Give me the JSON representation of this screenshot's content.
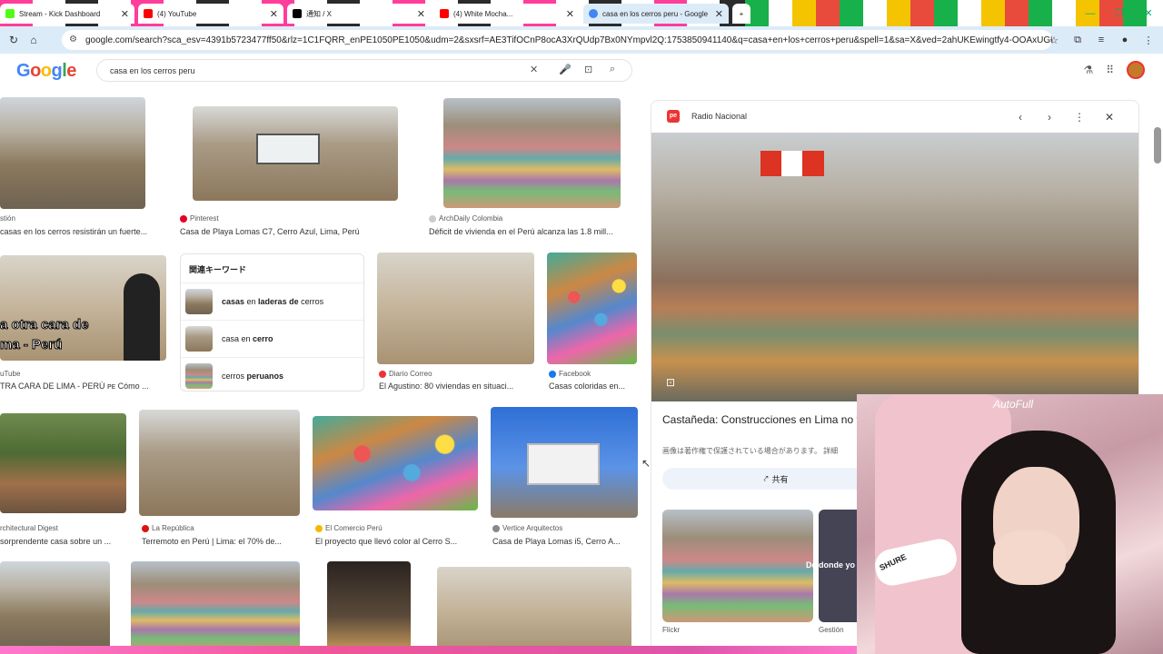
{
  "tabs": [
    {
      "label": "Stream - Kick Dashboard",
      "color": "#53fc18"
    },
    {
      "label": "(4) YouTube",
      "color": "#ff0000"
    },
    {
      "label": "通知 / X",
      "color": "#000000"
    },
    {
      "label": "(4) White Mocha...",
      "color": "#ff0000"
    },
    {
      "label": "casa en los cerros peru - Google",
      "color": "#4285f4"
    }
  ],
  "url": "google.com/search?sca_esv=4391b5723477ff50&rlz=1C1FQRR_enPE1050PE1050&udm=2&sxsrf=AE3TifOCnP8ocA3XrQUdp7Bx0NYmpvl2Q:1753850941140&q=casa+en+los+cerros+peru&spell=1&sa=X&ved=2ahUKEwingtfy4-OOAxUGkIYB...",
  "logo": "Google",
  "search": {
    "value": "casa en los cerros peru"
  },
  "results": {
    "r1": {
      "source": "stión",
      "title": "casas en los cerros resistirán un fuerte..."
    },
    "r2": {
      "source": "Pinterest",
      "title": "Casa de Playa Lomas C7, Cerro Azul, Lima, Perú"
    },
    "r3": {
      "source": "ArchDaily Colombia",
      "title": "Déficit de vivienda en el Perú alcanza las 1.8 mill..."
    },
    "r4": {
      "source": "uTube",
      "title": "TRA CARA DE LIMA - PERÚ",
      "overlay": "a otra cara de\nma - Perú"
    },
    "r5": {
      "source": "Diario Correo",
      "title": "El Agustino: 80 viviendas en situaci..."
    },
    "r6": {
      "source": "Facebook",
      "title": "Casas coloridas en..."
    },
    "r7": {
      "source": "rchitectural Digest",
      "title": "sorprendente casa sobre un ..."
    },
    "r8": {
      "source": "La República",
      "title": "Terremoto en Perú | Lima: el 70% de..."
    },
    "r9": {
      "source": "El Comercio Perú",
      "title": "El proyecto que llevó color al Cerro S..."
    },
    "r10": {
      "source": "Vertice Arquitectos",
      "title": "Casa de Playa Lomas i5, Cerro A..."
    }
  },
  "related": {
    "heading": "関連キーワード",
    "items": [
      {
        "pre": "casas",
        "mid": " en ",
        "post": "laderas de",
        "end": " cerros"
      },
      {
        "pre": "casa en ",
        "mid": "",
        "post": "cerro",
        "end": ""
      },
      {
        "pre": "cerros ",
        "mid": "",
        "post": "peruanos",
        "end": ""
      }
    ]
  },
  "panel": {
    "source": "Radio Nacional",
    "source_icon": "pe",
    "title": "Castañeda: Construcciones en Lima no terremoto similar a Chile | Radio Nacional",
    "note": "画像は著作権で保護されている場合があります。 詳細",
    "share": "共有",
    "rel1_source": "Flickr",
    "rel2_source": "Gestión",
    "rel2_label": "De donde yo"
  },
  "stream": {
    "chair_logo": "AutoFull",
    "mic_brand": "SHURE"
  }
}
